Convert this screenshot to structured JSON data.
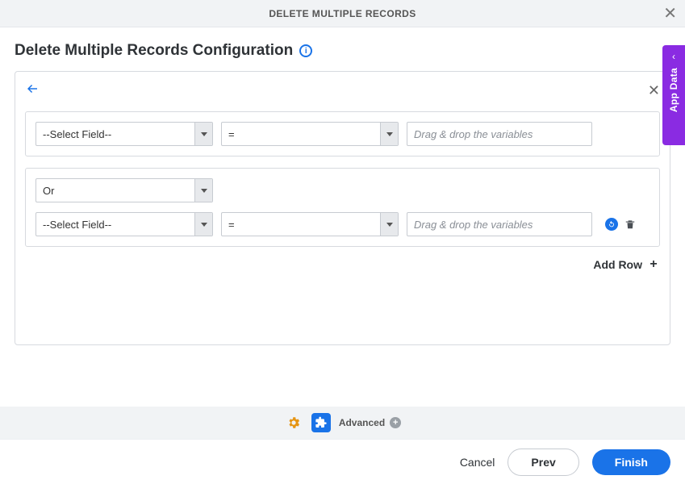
{
  "header": {
    "title": "DELETE MULTIPLE RECORDS"
  },
  "section": {
    "title": "Delete Multiple Records Configuration"
  },
  "sideTab": {
    "label": "App Data"
  },
  "builder": {
    "group1": {
      "rows": [
        {
          "field": "--Select Field--",
          "operator": "=",
          "valuePlaceholder": "Drag & drop the variables"
        }
      ]
    },
    "group2": {
      "logic": "Or",
      "rows": [
        {
          "field": "--Select Field--",
          "operator": "=",
          "valuePlaceholder": "Drag & drop the variables"
        }
      ]
    },
    "addRowLabel": "Add Row"
  },
  "advanced": {
    "label": "Advanced"
  },
  "footer": {
    "cancel": "Cancel",
    "prev": "Prev",
    "finish": "Finish"
  }
}
